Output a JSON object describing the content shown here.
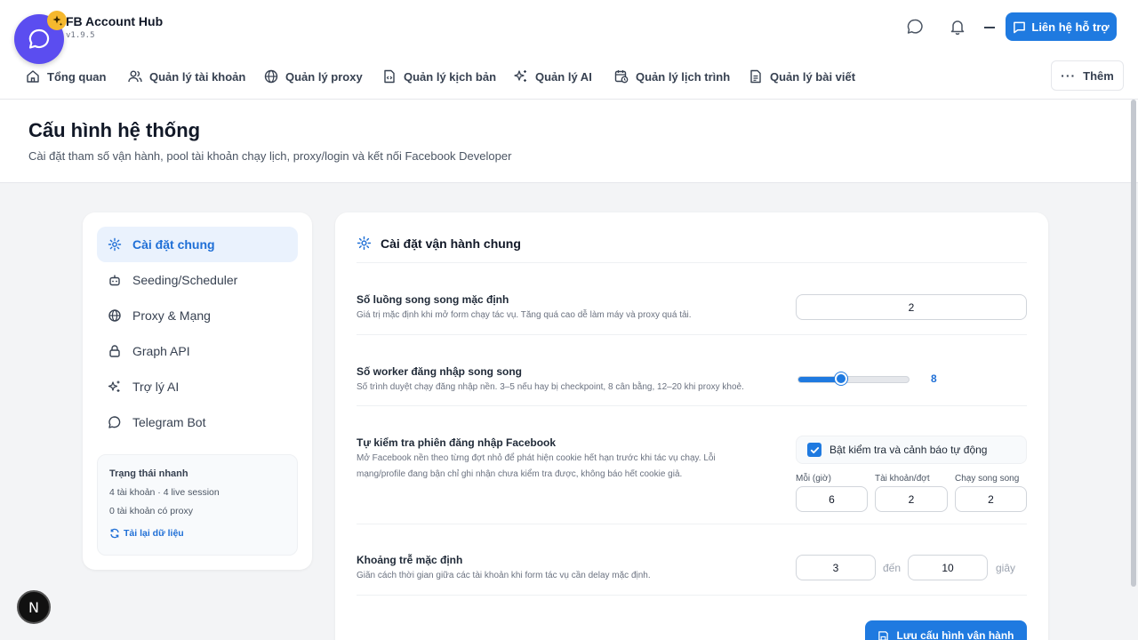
{
  "header": {
    "app_title": "FB Account Hub",
    "version": "v1.9.5",
    "support_label": "Liên hệ hỗ trợ"
  },
  "nav": {
    "items": [
      {
        "label": "Tổng quan",
        "icon": "home-icon"
      },
      {
        "label": "Quản lý tài khoản",
        "icon": "users-icon"
      },
      {
        "label": "Quản lý proxy",
        "icon": "globe-icon"
      },
      {
        "label": "Quản lý kịch bản",
        "icon": "script-icon"
      },
      {
        "label": "Quản lý AI",
        "icon": "sparkles-icon"
      },
      {
        "label": "Quản lý lịch trình",
        "icon": "calendar-clock-icon"
      },
      {
        "label": "Quản lý bài viết",
        "icon": "document-icon"
      }
    ],
    "more_label": "Thêm"
  },
  "page": {
    "title": "Cấu hình hệ thống",
    "subtitle": "Cài đặt tham số vận hành, pool tài khoản chạy lịch, proxy/login và kết nối Facebook Developer"
  },
  "sidebar": {
    "items": [
      {
        "label": "Cài đặt chung",
        "icon": "gear-icon",
        "active": true
      },
      {
        "label": "Seeding/Scheduler",
        "icon": "robot-icon",
        "active": false
      },
      {
        "label": "Proxy & Mạng",
        "icon": "globe-icon",
        "active": false
      },
      {
        "label": "Graph API",
        "icon": "lock-icon",
        "active": false
      },
      {
        "label": "Trợ lý AI",
        "icon": "sparkles-icon",
        "active": false
      },
      {
        "label": "Telegram Bot",
        "icon": "chat-icon",
        "active": false
      }
    ],
    "quick_status": {
      "title": "Trạng thái nhanh",
      "line1": "4 tài khoản · 4 live session",
      "line2": "0 tài khoản có proxy",
      "reload_label": "Tải lại dữ liệu"
    }
  },
  "settings": {
    "section_title": "Cài đặt vận hành chung",
    "threads": {
      "label": "Số luồng song song mặc định",
      "desc": "Giá trị mặc định khi mở form chạy tác vụ. Tăng quá cao dễ làm máy và proxy quá tải.",
      "value": "2"
    },
    "login_workers": {
      "label": "Số worker đăng nhập song song",
      "desc": "Số trình duyệt chạy đăng nhập nền. 3–5 nếu hay bị checkpoint, 8 cân bằng, 12–20 khi proxy khoẻ.",
      "value": "8",
      "fraction": 0.39
    },
    "session_check": {
      "label": "Tự kiểm tra phiên đăng nhập Facebook",
      "desc": "Mở Facebook nền theo từng đợt nhỏ để phát hiện cookie hết hạn trước khi tác vụ chạy. Lỗi mạng/profile đang bận chỉ ghi nhận chưa kiểm tra được, không báo hết cookie giả.",
      "checkbox_label": "Bật kiểm tra và cảnh báo tự động",
      "checked": true,
      "every_label": "Mỗi (giờ)",
      "every_value": "6",
      "batch_label": "Tài khoản/đợt",
      "batch_value": "2",
      "parallel_label": "Chạy song song",
      "parallel_value": "2"
    },
    "delay": {
      "label": "Khoảng trễ mặc định",
      "desc": "Giãn cách thời gian giữa các tài khoản khi form tác vụ cần delay mặc định.",
      "from": "3",
      "to_label": "đến",
      "to": "10",
      "unit": "giây"
    },
    "save_label": "Lưu cấu hình vận hành"
  },
  "dev_badge": "N",
  "colors": {
    "accent": "#1f7ae0",
    "logo": "#5b4df0",
    "badge": "#f5b82e"
  }
}
